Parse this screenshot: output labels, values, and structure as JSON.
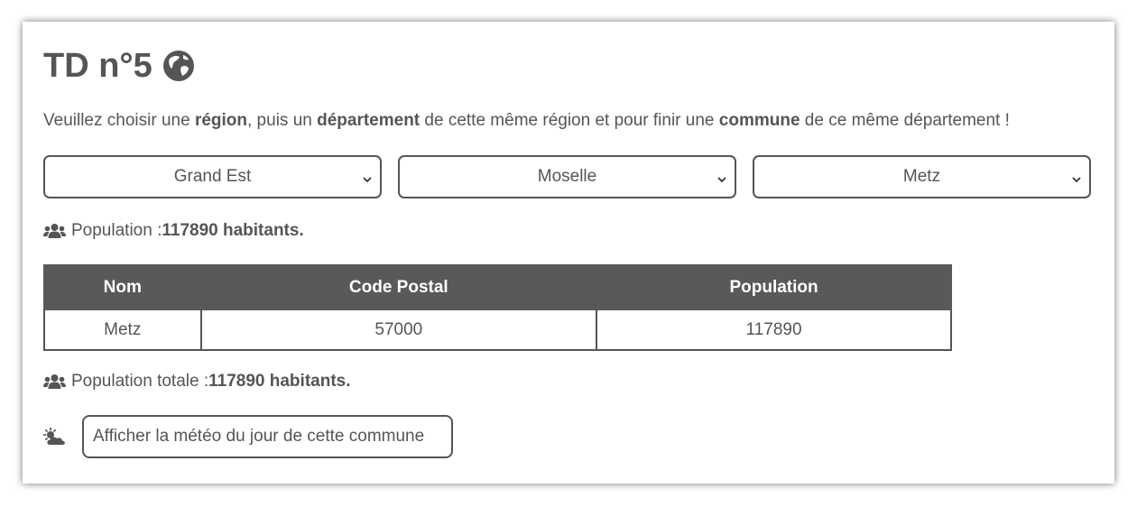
{
  "title": "TD n°5",
  "intro": {
    "p1": "Veuillez choisir une ",
    "b1": "région",
    "p2": ", puis un ",
    "b2": "département",
    "p3": " de cette même région et pour finir une ",
    "b3": "commune",
    "p4": " de ce même département !"
  },
  "selects": {
    "region": "Grand Est",
    "departement": "Moselle",
    "commune": "Metz"
  },
  "population": {
    "label": "Population : ",
    "value": "117890 habitants."
  },
  "table": {
    "headers": [
      "Nom",
      "Code Postal",
      "Population"
    ],
    "rows": [
      [
        "Metz",
        "57000",
        "117890"
      ]
    ]
  },
  "total": {
    "label": "Population totale : ",
    "value": "117890 habitants."
  },
  "weather_button": "Afficher la météo du jour de cette commune",
  "icons": [
    "globe-icon",
    "chevron-down-icon",
    "users-icon",
    "cloud-sun-icon"
  ],
  "colors": {
    "text": "#555555",
    "table_header": "#595959"
  }
}
